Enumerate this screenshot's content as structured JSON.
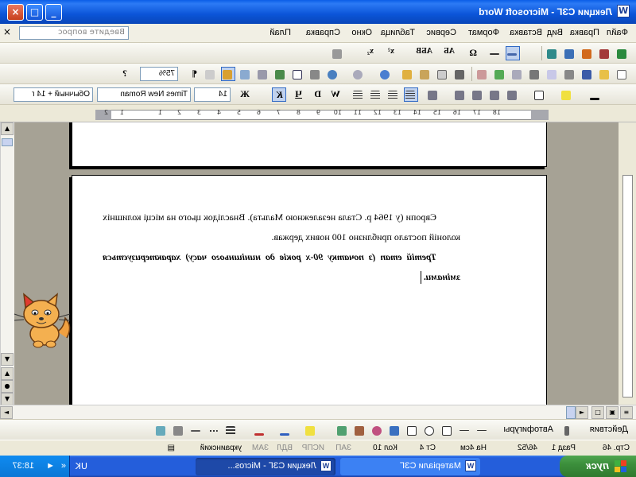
{
  "window": {
    "title": "Лекции СЗГ - Microsoft Word",
    "app_letter": "W",
    "controls": {
      "minimize": "_",
      "maximize": "□",
      "close": "×"
    }
  },
  "menu": {
    "items": [
      "Файл",
      "Правка",
      "Вид",
      "Вставка",
      "Формат",
      "Сервис",
      "Таблица",
      "Окно",
      "Справка",
      "Плай"
    ],
    "ask_placeholder": "Введите вопрос",
    "close_doc": "×"
  },
  "formatting_toolbar": {
    "style": "Обычный + 14 г",
    "font": "Times New Roman",
    "size": "14",
    "bold": "Ж",
    "italic": "К",
    "underline": "Ч",
    "strike": "W",
    "word_art": "D"
  },
  "standard_toolbar": {
    "zoom": "75%",
    "help": "?"
  },
  "ruler": {
    "numbers": [
      "2",
      "1",
      "1",
      "2",
      "3",
      "4",
      "5",
      "6",
      "7",
      "8",
      "9",
      "10",
      "11",
      "12",
      "13",
      "14",
      "15",
      "16",
      "17",
      "18"
    ]
  },
  "document": {
    "paragraphs": [
      {
        "text": "Європи (у 1964 р. Стала незалежною Мальта). Внаслідок цього на місці колишніх колоній постало приблизно 100 нових держав.",
        "bold": false
      },
      {
        "text": "Третій етап (з початку 90-х років до нинішнього часу) характеризується змінами.",
        "bold": true
      }
    ]
  },
  "drawing_toolbar": {
    "actions": "Действия",
    "autoshapes": "Автофигуры"
  },
  "status_bar": {
    "page": "Стр. 46",
    "section": "Разд 1",
    "pages": "46/52",
    "at": "На 4см",
    "line": "Ст 4",
    "column": "Кол 10",
    "rec": "ЗАП",
    "trk": "ИСПР",
    "ext": "ВДЛ",
    "ovr": "ЗАМ",
    "language": "украинский"
  },
  "taskbar": {
    "start": "пуск",
    "tasks": [
      {
        "label": "Матеріали СЗГ",
        "active": false
      },
      {
        "label": "Лекции СЗГ - Micros...",
        "active": true
      }
    ],
    "language": "UK",
    "clock": "18:37"
  }
}
